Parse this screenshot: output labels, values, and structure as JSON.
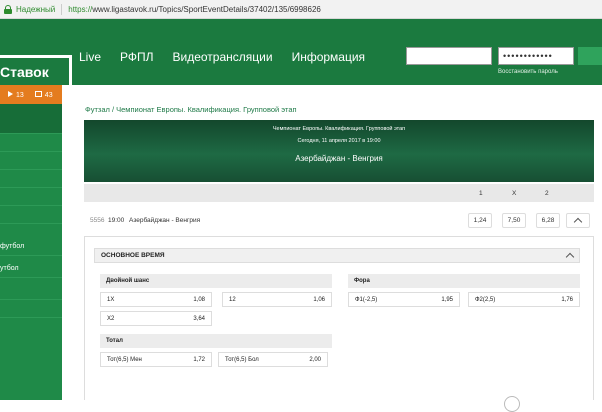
{
  "browser": {
    "secure_label": "Надежный",
    "url_proto": "https://",
    "url_rest": "www.ligastavok.ru/Topics/SportEventDetails/37402/135/6998626"
  },
  "header": {
    "logo_text": "Ставок",
    "nav": [
      "Live",
      "РФПЛ",
      "Видеотрансляции",
      "Информация"
    ],
    "login_value": "",
    "password_value": "••••••••••••",
    "forgot_label": "Восстановить пароль"
  },
  "sidebar": {
    "live_count": "13",
    "video_count": "43",
    "items": [
      "",
      "",
      "",
      "",
      "футбол",
      "утбол",
      "",
      "",
      "",
      ""
    ]
  },
  "breadcrumb": "Футзал / Чемпионат Европы. Квалификация. Групповой этап",
  "banner": {
    "competition": "Чемпионат Европы. Квалификация. Групповой этап",
    "datetime": "Сегодня, 11 апреля 2017 в 19:00",
    "match": "Азербайджан - Венгрия"
  },
  "odds_header": [
    "1",
    "X",
    "2"
  ],
  "event": {
    "code": "5556",
    "time": "19:00",
    "name": "Азербайджан - Венгрия",
    "odds": [
      "1,24",
      "7,50",
      "6,28"
    ]
  },
  "markets": {
    "section_title": "ОСНОВНОЕ ВРЕМЯ",
    "double_chance": {
      "title": "Двойной шанс",
      "outcomes": [
        {
          "label": "1X",
          "value": "1,08"
        },
        {
          "label": "12",
          "value": "1,06"
        },
        {
          "label": "X2",
          "value": "3,64"
        }
      ]
    },
    "handicap": {
      "title": "Фора",
      "outcomes": [
        {
          "label": "Ф1(-2,5)",
          "value": "1,95"
        },
        {
          "label": "Ф2(2,5)",
          "value": "1,76"
        }
      ]
    },
    "total": {
      "title": "Тотал",
      "outcomes": [
        {
          "label": "Тот(6,5) Мен",
          "value": "1,72"
        },
        {
          "label": "Тот(6,5) Бол",
          "value": "2,00"
        }
      ]
    }
  },
  "colors": {
    "header_green": "#1b7a3f",
    "sidebar_green": "#1f8a48",
    "counter_orange": "#e47c1f",
    "link_green": "#1f7a48"
  }
}
